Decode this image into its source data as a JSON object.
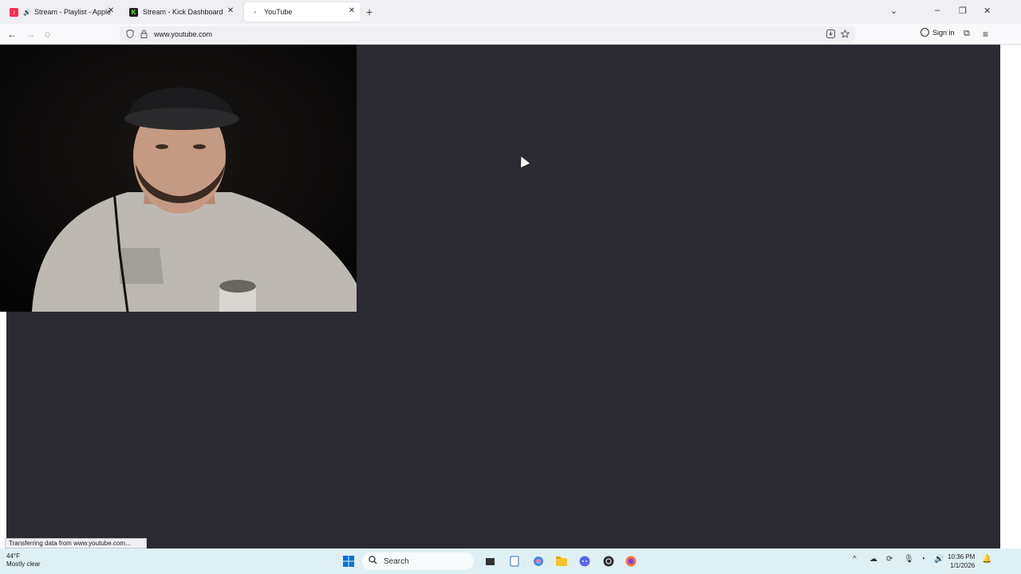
{
  "browser": {
    "tabs": [
      {
        "label": "Stream - Playlist - Apple Mu",
        "favicon_color": "#fa2d48",
        "favicon_glyph": "♪",
        "speaker": "🔊",
        "close": "✕"
      },
      {
        "label": "Stream - Kick Dashboard",
        "favicon_color": "#53fc18",
        "favicon_glyph": "K",
        "close": "✕"
      },
      {
        "label": "YouTube",
        "favicon_color": "#999999",
        "favicon_glyph": "•",
        "close": "✕"
      }
    ],
    "new_tab": "+",
    "list_tabs": "⌄",
    "window_controls": {
      "minimize": "–",
      "restore": "❐",
      "close": "✕"
    },
    "nav": {
      "back": "←",
      "forward": "→",
      "reload": "◌"
    },
    "url": "www.youtube.com",
    "sign_in": "Sign in",
    "menu": "≡",
    "extensions": "⧉"
  },
  "status_bar": {
    "text": "Transferring data from www.youtube.com..."
  },
  "taskbar": {
    "weather_temp": "44°F",
    "weather_desc": "Mostly clear",
    "search_label": "Search",
    "clock_time": "10:36 PM",
    "clock_date": "1/1/2026"
  }
}
